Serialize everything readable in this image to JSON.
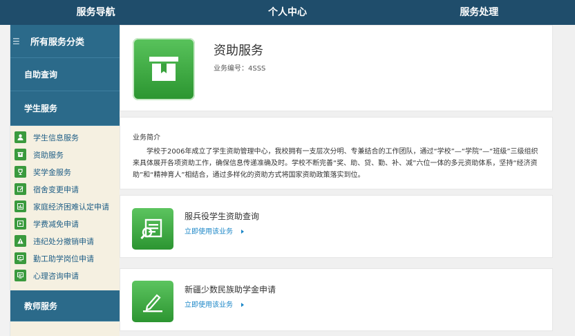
{
  "topnav": {
    "items": [
      {
        "label": "服务导航"
      },
      {
        "label": "个人中心"
      },
      {
        "label": "服务处理"
      }
    ]
  },
  "sidebar": {
    "all_label": "所有服务分类",
    "cat_zizhu": "自助查询",
    "cat_xuesheng": "学生服务",
    "cat_jiaoshi": "教师服务",
    "items": [
      {
        "label": "学生信息服务",
        "icon": "person-icon"
      },
      {
        "label": "资助服务",
        "icon": "box-icon"
      },
      {
        "label": "奖学金服务",
        "icon": "trophy-icon"
      },
      {
        "label": "宿舍变更申请",
        "icon": "edit-icon"
      },
      {
        "label": "家庭经济困难认定申请",
        "icon": "chart-icon"
      },
      {
        "label": "学费减免申请",
        "icon": "play-icon"
      },
      {
        "label": "违纪处分撤销申请",
        "icon": "warning-icon"
      },
      {
        "label": "勤工助学岗位申请",
        "icon": "monitor-icon"
      },
      {
        "label": "心理咨询申请",
        "icon": "consult-icon"
      }
    ]
  },
  "hero": {
    "title": "资助服务",
    "code": "业务编号：4SSS"
  },
  "intro": {
    "heading": "业务简介",
    "body": "学校于2006年成立了学生资助管理中心，我校拥有一支层次分明、专兼结合的工作团队，通过“学校”—“学院”—“班级”三级组织来具体展开各项资助工作，确保信息传递准确及时。学校不断完善“奖、助、贷、勤、补、减”六位一体的多元资助体系，坚持“经济资助”和“精神育人”相结合，通过多样化的资助方式将国家资助政策落实到位。"
  },
  "services": [
    {
      "title": "服兵役学生资助查询",
      "link": "立即使用该业务"
    },
    {
      "title": "新疆少数民族助学金申请",
      "link": "立即使用该业务"
    }
  ],
  "colors": {
    "topnav": "#1f4d6b",
    "sidebar_cat": "#2b6a8a",
    "green": "#3a9a3d",
    "link": "#1a86c7"
  }
}
